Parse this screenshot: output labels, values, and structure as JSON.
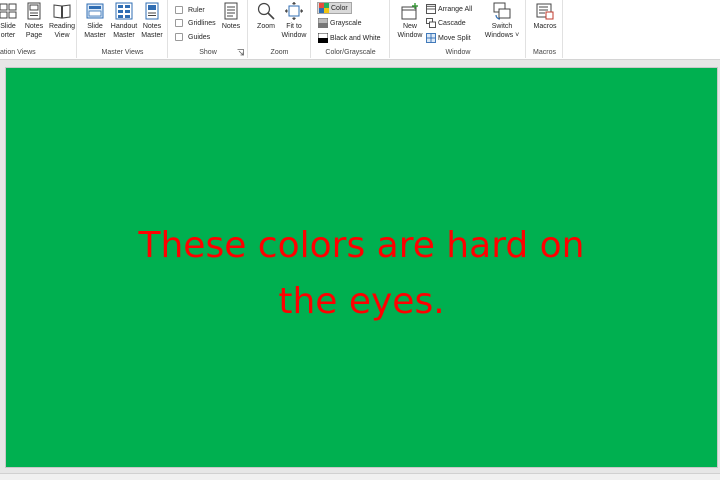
{
  "ribbon": {
    "presentation_views": {
      "label": "ation Views",
      "slide_sorter": "Slide\norter",
      "notes_page": "Notes\nPage",
      "reading_view": "Reading\nView"
    },
    "master_views": {
      "label": "Master Views",
      "slide_master": "Slide\nMaster",
      "handout_master": "Handout\nMaster",
      "notes_master": "Notes\nMaster"
    },
    "show": {
      "label": "Show",
      "ruler": "Ruler",
      "gridlines": "Gridlines",
      "guides": "Guides",
      "notes": "Notes"
    },
    "zoom": {
      "label": "Zoom",
      "zoom": "Zoom",
      "fit_to_window": "Fit to\nWindow"
    },
    "color_grayscale": {
      "label": "Color/Grayscale",
      "color": "Color",
      "grayscale": "Grayscale",
      "black_and_white": "Black and White"
    },
    "window": {
      "label": "Window",
      "new_window": "New\nWindow",
      "arrange_all": "Arrange All",
      "cascade": "Cascade",
      "move_split": "Move Split",
      "switch_windows": "Switch\nWindows ˅"
    },
    "macros": {
      "label": "Macros",
      "macros": "Macros"
    }
  },
  "slide": {
    "text": "These colors are hard on\nthe eyes.",
    "background_color": "#00b050",
    "text_color": "#ff0000"
  }
}
